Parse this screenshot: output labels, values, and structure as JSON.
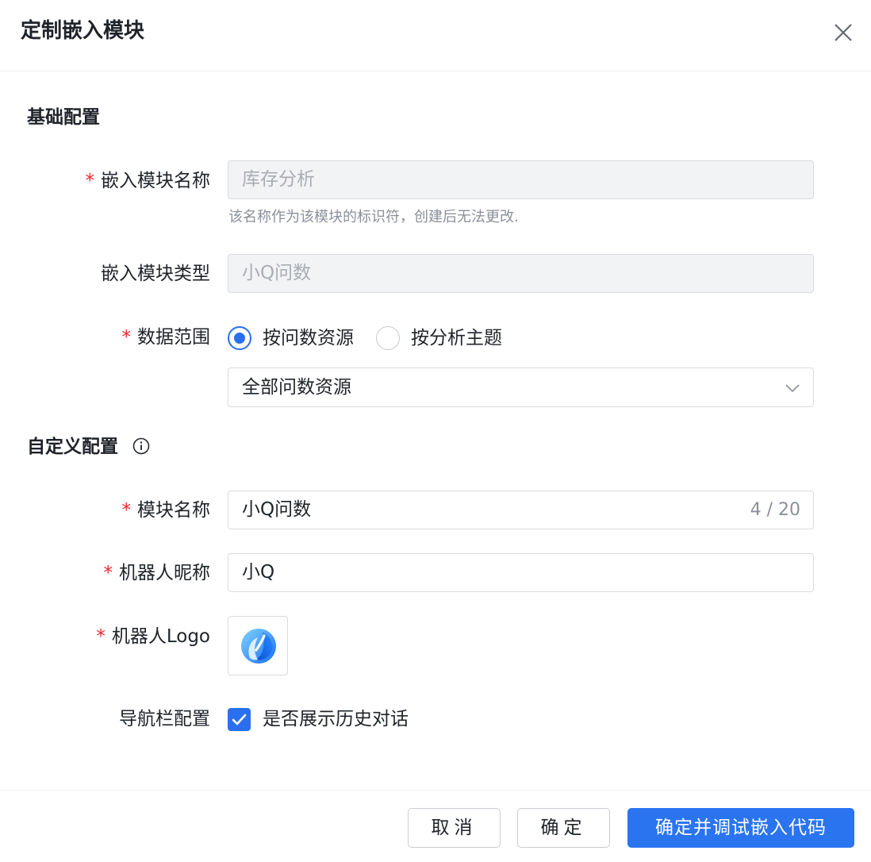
{
  "dialog": {
    "title": "定制嵌入模块"
  },
  "basic": {
    "section_title": "基础配置",
    "module_name": {
      "required_mark": "*",
      "label": "嵌入模块名称",
      "value": "库存分析",
      "hint": "该名称作为该模块的标识符，创建后无法更改."
    },
    "module_type": {
      "label": "嵌入模块类型",
      "value": "小Q问数"
    },
    "data_scope": {
      "required_mark": "*",
      "label": "数据范围",
      "options": [
        {
          "label": "按问数资源",
          "checked": true
        },
        {
          "label": "按分析主题",
          "checked": false
        }
      ],
      "select_value": "全部问数资源"
    }
  },
  "custom": {
    "section_title": "自定义配置",
    "info_icon": "info-circle-icon",
    "title_name": {
      "required_mark": "*",
      "label": "模块名称",
      "value": "小Q问数",
      "counter": "4 / 20"
    },
    "bot_nickname": {
      "required_mark": "*",
      "label": "机器人昵称",
      "value": "小Q"
    },
    "bot_logo": {
      "required_mark": "*",
      "label": "机器人Logo",
      "icon": "bot-logo-icon"
    },
    "navbar": {
      "label": "导航栏配置",
      "checkbox_label": "是否展示历史对话",
      "checked": true
    }
  },
  "footer": {
    "cancel_label": "取消",
    "confirm_label": "确定",
    "confirm_debug_label": "确定并调试嵌入代码"
  },
  "colors": {
    "primary": "#2a74f0",
    "required": "#f5222d",
    "disabled_bg": "#f2f3f5"
  }
}
